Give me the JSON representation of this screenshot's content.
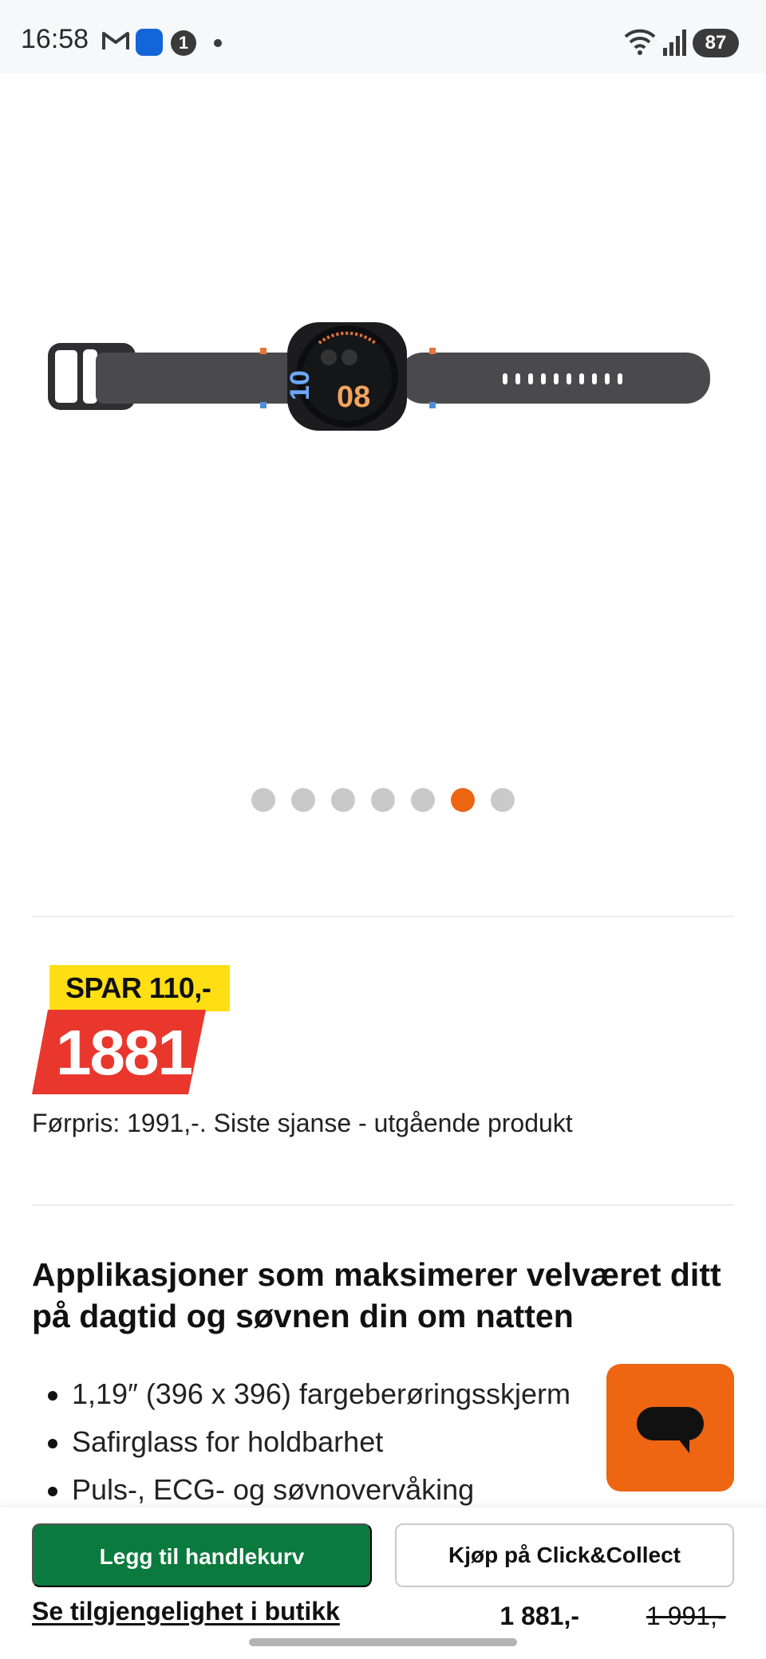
{
  "status_bar": {
    "time": "16:58",
    "battery": "87",
    "notification_badge": "1",
    "icons": [
      "gmail-icon",
      "app-icon",
      "notification-count-icon",
      "dot-icon",
      "wifi-icon",
      "signal-icon",
      "battery-icon"
    ]
  },
  "gallery": {
    "dot_count": 7,
    "active_index": 5,
    "accent_color": "#ee6512"
  },
  "price": {
    "save_label": "SPAR 110,-",
    "current": "1881",
    "note": "Førpris: 1991,-. Siste sjanse - utgående produkt"
  },
  "description": {
    "headline": "Applikasjoner som maksimerer velværet ditt på dagtid og søvnen din om natten",
    "features": [
      "1,19″ (396 x 396) fargeberøringsskjerm",
      "Safirglass for holdbarhet",
      "Puls-, ECG- og søvnovervåking"
    ]
  },
  "chat": {
    "icon": "chat-bubble-icon"
  },
  "bottom_bar": {
    "add_to_cart": "Legg til handlekurv",
    "click_collect": "Kjøp på Click&Collect",
    "store_availability": "Se tilgjengelighet i butikk",
    "price": "1 881,-",
    "old_price": "1 991,-",
    "primary_color": "#0b7a3e"
  }
}
